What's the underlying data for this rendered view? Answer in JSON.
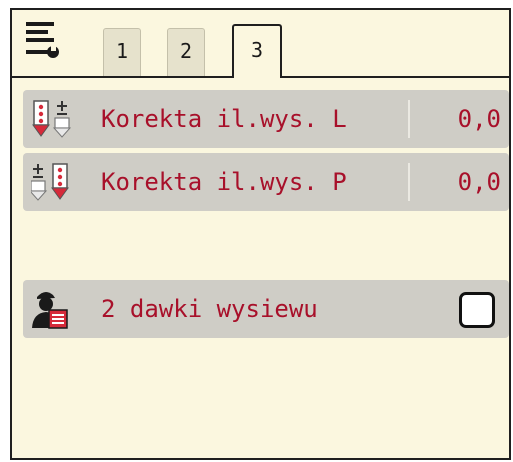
{
  "tabs": [
    {
      "label": "1",
      "active": false
    },
    {
      "label": "2",
      "active": false
    },
    {
      "label": "3",
      "active": true
    }
  ],
  "rows": [
    {
      "label": "Korekta il.wys. L",
      "value": "0,0",
      "icon": "rate-correction-left-icon"
    },
    {
      "label": "Korekta il.wys. P",
      "value": "0,0",
      "icon": "rate-correction-right-icon"
    }
  ],
  "option": {
    "label": "2 dawki wysiewu",
    "checked": false,
    "icon": "operator-document-icon"
  },
  "colors": {
    "accent_text": "#a8102a",
    "screen_bg": "#fbf7df",
    "row_bg": "#cfcdc6",
    "icon_red": "#d62a3a"
  }
}
